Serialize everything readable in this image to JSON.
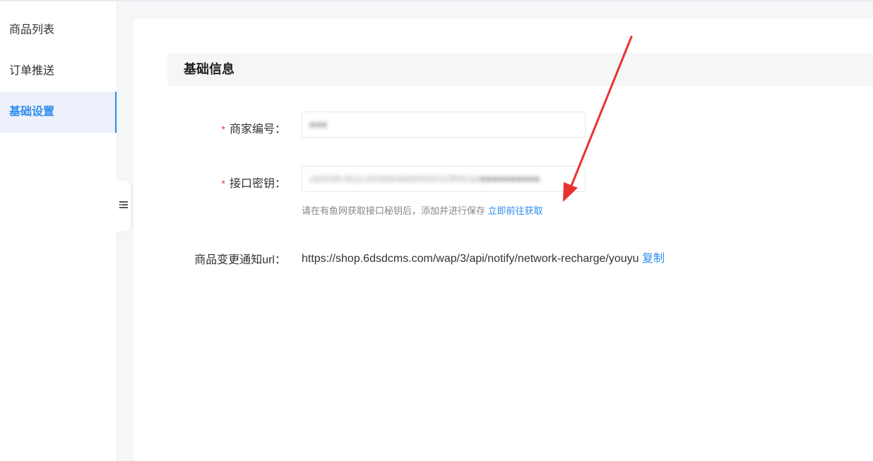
{
  "sidebar": {
    "items": [
      {
        "label": "商品列表",
        "active": false
      },
      {
        "label": "订单推送",
        "active": false
      },
      {
        "label": "基础设置",
        "active": true
      }
    ]
  },
  "collapse_icon": "collapse-menu-icon",
  "section": {
    "title": "基础信息"
  },
  "form": {
    "merchant_id": {
      "label": "商家编号",
      "required_mark": "*",
      "value": "■■■"
    },
    "api_key": {
      "label": "接口密钥",
      "required_mark": "*",
      "value": "cb004fc4b1c300fd84bfdf400010ff4fcbd■■■■■■■■■■",
      "hint": "请在有鱼网获取接口秘钥后，添加并进行保存",
      "hint_link": "立即前往获取"
    },
    "notify_url": {
      "label": "商品变更通知url",
      "value": "https://shop.6dsdcms.com/wap/3/api/notify/network-recharge/youyu",
      "copy_label": "复制"
    }
  },
  "colors": {
    "accent": "#2d8cf0",
    "required": "#e33333",
    "annotation_arrow": "#e8322f"
  }
}
